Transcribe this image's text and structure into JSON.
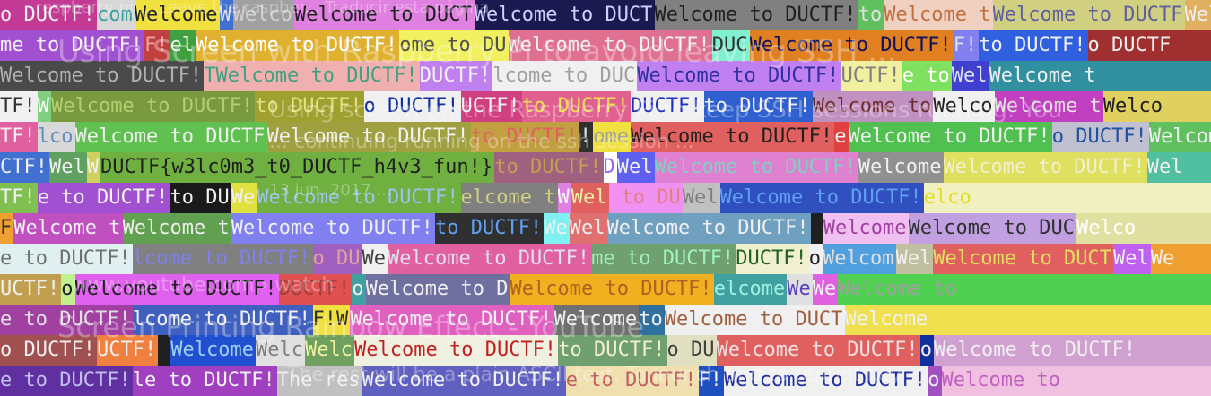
{
  "background_ghost": [
    "respberry pi ... Leave the raspber... Traducir esta página",
    "Using Screen with Raspberry Pi to avoid leaving SSH ...",
    "Using screen on the Raspberry Pi to keep SSH sessions running. You",
    "... continuing running on the ssh session ...",
    "13 jun. 2017 ...",
    "www.youtube.com › watch",
    "Screen Printing Rainbow Effect - YouTube",
    "The rest will be a plain ASCII text. To launch and to reprint key"
  ],
  "flag_text": "DUCTF{w3lc0m3_t0_DUCTF_h4v3_fun!}",
  "rows": [
    [
      [
        "o DUCTF!",
        "#c23a94",
        "#f0f0f0"
      ],
      [
        "com",
        "#d8d8d8",
        "#3aa0a0"
      ],
      [
        "Welcome",
        "#f0e040",
        "#202020"
      ],
      [
        "W",
        "#4070d0",
        "#e0e0e0"
      ],
      [
        "Welco",
        "#a0a0a0",
        "#d0d0d0"
      ],
      [
        "Welcome to DUCT",
        "#e080e0",
        "#202020"
      ],
      [
        "Welcome to DUCT",
        "#1a1a50",
        "#d0d0ff"
      ],
      [
        "Welcome to DUCTF!",
        "#808080",
        "#202020"
      ],
      [
        "to",
        "#60c060",
        "#e0e0e0"
      ],
      [
        "Welcome t",
        "#f0d0c0",
        "#c07040"
      ],
      [
        "Welcome to DUCTF",
        "#d0d080",
        "#6060a0"
      ],
      [
        "Welcome to",
        "#e0b060",
        "#f0f0f0"
      ]
    ],
    [
      [
        "me to DUCTF!",
        "#a050d0",
        "#f0f0f0"
      ],
      [
        "F!",
        "#c04040",
        "#f0a0a0"
      ],
      [
        "el",
        "#40a040",
        "#f0f0f0"
      ],
      [
        "Welcome to DUCTF!",
        "#e0b030",
        "#ffffff"
      ],
      [
        "ome to DU",
        "#f0f060",
        "#505050"
      ],
      [
        "Welcome to DUCTF!",
        "#e07090",
        "#f0f0f0"
      ],
      [
        "DUC",
        "#80f0d0",
        "#303030"
      ],
      [
        "Welcome to DUCTF!",
        "#e08020",
        "#101060"
      ],
      [
        "F!",
        "#8080f0",
        "#e0e0e0"
      ],
      [
        "to DUCTF!",
        "#3060e0",
        "#f0f0f0"
      ],
      [
        "o DUCTF",
        "#a03030",
        "#f0f0f0"
      ]
    ],
    [
      [
        "Welcome to DUCTF!",
        "#4a4a4a",
        "#b0b0b0"
      ],
      [
        "TWelcome to DUCTF!",
        "#f0b0b0",
        "#40a080"
      ],
      [
        "DUCTF!",
        "#c080f0",
        "#f0f0f0"
      ],
      [
        "lcome to DUC",
        "#f0f0f0",
        "#a0a0a0"
      ],
      [
        "Welcome to DUCTF!",
        "#c080f0",
        "#3030a0"
      ],
      [
        "UCTF!",
        "#f0f0a0",
        "#808080"
      ],
      [
        "e to",
        "#80e060",
        "#ffffff"
      ],
      [
        "Wel",
        "#4040d0",
        "#e0e0f0"
      ],
      [
        "Welcome t",
        "#3090a0",
        "#f0f0f0"
      ]
    ],
    [
      [
        "TF!",
        "#f0f0f0",
        "#303030"
      ],
      [
        "W",
        "#80d080",
        "#ffffff"
      ],
      [
        "Welcome to DUCTF!",
        "#7a9a40",
        "#b0d070"
      ],
      [
        "to DUCTF!",
        "#a0a030",
        "#e0e080"
      ],
      [
        "o DUCTF!",
        "#f0f0f0",
        "#1030a0"
      ],
      [
        "UCTF!",
        "#d04080",
        "#f0f0f0"
      ],
      [
        "to DUCTF!",
        "#e06090",
        "#f0e050"
      ],
      [
        "DUCTF!",
        "#f0f0f0",
        "#2030c0"
      ],
      [
        "to DUCTF!",
        "#3060d0",
        "#f0f0f0"
      ],
      [
        "Welcome to",
        "#c090c0",
        "#703030"
      ],
      [
        "Welco",
        "#f0f0f0",
        "#202020"
      ],
      [
        "Welcome t",
        "#c040c0",
        "#e0e0e0"
      ],
      [
        "Welco",
        "#e0d060",
        "#202020"
      ]
    ],
    [
      [
        "TF!",
        "#e060a0",
        "#f0f0f0"
      ],
      [
        "lco",
        "#d8d8d8",
        "#6090c0"
      ],
      [
        "Welcome to DUCTF",
        "#60c050",
        "#f0f0f0"
      ],
      [
        "Welcome to DUCTF!",
        "#a0a040",
        "#f0f0f0"
      ],
      [
        "to DUCTF!",
        "#c0a040",
        "#e06060"
      ],
      [
        "!",
        "#303030",
        "#e0e0e0"
      ],
      [
        "ome",
        "#f0e040",
        "#a0a0a0"
      ],
      [
        "Welcome to DUCTF!",
        "#e06060",
        "#202020"
      ],
      [
        "e",
        "#e04040",
        "#f0f0f0"
      ],
      [
        "Welcome to DUCTF!",
        "#50c050",
        "#f0f0f0"
      ],
      [
        "o DUCTF!",
        "#c0c0d0",
        "#2050a0"
      ],
      [
        "Welcome t",
        "#60c060",
        "#f0f0f0"
      ]
    ],
    [
      [
        "CTF!",
        "#4070d0",
        "#f0f0f0"
      ],
      [
        "Wel",
        "#60a060",
        "#f0f0f0"
      ],
      [
        "W",
        "#d0d060",
        "#f0f0f0"
      ],
      [
        "DUCTF{w3lc0m3_t0_DUCTF_h4v3_fun!}",
        "#70b040",
        "#202020"
      ],
      [
        "to DUCTF!",
        "#a06080",
        "#c0a050"
      ],
      [
        "D",
        "#ffffff",
        "#a060f0"
      ],
      [
        "Wel",
        "#6060f0",
        "#f0f0f0"
      ],
      [
        "Welcome to DUCTF!",
        "#e080d0",
        "#80d0c0"
      ],
      [
        "Welcome",
        "#909090",
        "#f0f0f0"
      ],
      [
        "Welcome to DUCTF!",
        "#e0e060",
        "#f0f0d0"
      ],
      [
        "Wel",
        "#50c0a0",
        "#f0f0f0"
      ]
    ],
    [
      [
        "TF!",
        "#80c050",
        "#f0f0f0"
      ],
      [
        "e to DUCTF!",
        "#a050d0",
        "#f0f0f0"
      ],
      [
        "to DU",
        "#1a1a1a",
        "#f0f0f0"
      ],
      [
        "We",
        "#e0e040",
        "#f0f0f0"
      ],
      [
        "Welcome to DUCTF!",
        "#70b040",
        "#a0c0f0"
      ],
      [
        "elcome t",
        "#808080",
        "#d0d080"
      ],
      [
        "W",
        "#e080e0",
        "#ffffff"
      ],
      [
        "Wel",
        "#e06060",
        "#f0f0a0"
      ],
      [
        "",
        "#f090f0",
        "#f0f0f0"
      ],
      [
        "to DU",
        "#f090f0",
        "#e08080"
      ],
      [
        "Wel",
        "#c0c0c0",
        "#808080"
      ],
      [
        "Welcome to DUCTF!",
        "#3050c0",
        "#60a0f0"
      ],
      [
        "elco",
        "#f0f0c0",
        "#e0e020"
      ]
    ],
    [
      [
        "F",
        "#f0a030",
        "#303030"
      ],
      [
        "Welcome t",
        "#c050c0",
        "#f0f0f0"
      ],
      [
        "Welcome t",
        "#60a050",
        "#f0f0f0"
      ],
      [
        "Welcome to DUCTF!",
        "#8080f0",
        "#f0f0f0"
      ],
      [
        "to DUCTF!",
        "#303030",
        "#60a0f0"
      ],
      [
        "We",
        "#80f0f0",
        "#f0f0f0"
      ],
      [
        "Wel",
        "#e07070",
        "#f0f0f0"
      ],
      [
        "Welcome to DUCTF!",
        "#70a0c0",
        "#f0f0f0"
      ],
      [
        "",
        "#202020",
        "#f0f0f0"
      ],
      [
        "Welcome",
        "#f0c0f0",
        "#a040a0"
      ],
      [
        "Welcome to DUC",
        "#c0a0e0",
        "#303030"
      ],
      [
        "Welco",
        "#e0e0a0",
        "#ffffff"
      ]
    ],
    [
      [
        "e to DUCTF!",
        "#e0f0f0",
        "#707070"
      ],
      [
        "lcome to DUCTF!",
        "#808080",
        "#8080f0"
      ],
      [
        "o DU",
        "#a060c0",
        "#e0a0a0"
      ],
      [
        "We",
        "#f0f0f0",
        "#404040"
      ],
      [
        "Welcome to DUCTF!",
        "#e060a0",
        "#e0e0f0"
      ],
      [
        "me to DUCTF!",
        "#70a070",
        "#a0f0c0"
      ],
      [
        "DUCTF!",
        "#f0f0d0",
        "#206020"
      ],
      [
        "o",
        "#f0f0f0",
        "#202020"
      ],
      [
        "Welcom",
        "#50a0e0",
        "#e0e0e0"
      ],
      [
        "Wel",
        "#c0c0a0",
        "#f0f0f0"
      ],
      [
        "Welcome to DUCT",
        "#e06060",
        "#e0e060"
      ],
      [
        "Wel",
        "#c060f0",
        "#f0f0f0"
      ],
      [
        "We",
        "#f0a030",
        "#f0f0f0"
      ]
    ],
    [
      [
        "UCTF!",
        "#c0a050",
        "#f0f0f0"
      ],
      [
        "o",
        "#c0f090",
        "#202020"
      ],
      [
        "Welcome to DUCTF!",
        "#e060f0",
        "#202020"
      ],
      [
        "DUCTF!",
        "#e05050",
        "#a04040"
      ],
      [
        "o",
        "#40a0a0",
        "#f0f0f0"
      ],
      [
        "Welcome to D",
        "#7070a0",
        "#f0f0f0"
      ],
      [
        "Welcome to DUCTF!",
        "#f0b020",
        "#b06020"
      ],
      [
        "elcome",
        "#40a0a0",
        "#a0f0e0"
      ],
      [
        "We",
        "#e0e0e0",
        "#6040c0"
      ],
      [
        "We",
        "#e060e0",
        "#f0f0f0"
      ],
      [
        "Welcome to",
        "#50d050",
        "#a0a0a0"
      ]
    ],
    [
      [
        "e to DUCTF!",
        "#a040a0",
        "#e0e0e0"
      ],
      [
        "lcome to DUCTF!",
        "#4060c0",
        "#f0f0f0"
      ],
      [
        "F!W",
        "#f0e040",
        "#303030"
      ],
      [
        "Welcome to DUCTF!",
        "#e060c0",
        "#f0f0f0"
      ],
      [
        "Welcome",
        "#707070",
        "#f0f0f0"
      ],
      [
        "to",
        "#3070a0",
        "#f0f0f0"
      ],
      [
        "Welcome to DUCT",
        "#f0f0f0",
        "#a06040"
      ],
      [
        "Welcome",
        "#f0e050",
        "#f0f0f0"
      ]
    ],
    [
      [
        "o DUCTF!",
        "#a05050",
        "#f0f0f0"
      ],
      [
        "UCTF!",
        "#f08040",
        "#f0f0f0"
      ],
      [
        "",
        "#202020",
        "#f0f0f0"
      ],
      [
        "Welcome",
        "#2050d0",
        "#a0d0f0"
      ],
      [
        "Welc",
        "#e0e0e0",
        "#808080"
      ],
      [
        "Welc",
        "#70a060",
        "#f0f0a0"
      ],
      [
        "Welcome to DUCTF!",
        "#f0f0e0",
        "#c02020"
      ],
      [
        "to DUCTF!",
        "#70a070",
        "#f0f0d0"
      ],
      [
        "o DU",
        "#e0e0c0",
        "#404040"
      ],
      [
        "Welcome to DUCTF!",
        "#e06060",
        "#f0e0e0"
      ],
      [
        "o",
        "#1030a0",
        "#f0f0f0"
      ],
      [
        "Welcome to DUCTF!",
        "#d0a0d0",
        "#f0f0f0"
      ]
    ],
    [
      [
        "e to DUCTF!",
        "#6030a0",
        "#c0c0f0"
      ],
      [
        "le to DUCTF!",
        "#a040c0",
        "#f0f0f0"
      ],
      [
        "The res",
        "#c0c0c0",
        "#f0f0f0"
      ],
      [
        "Welcome to DUCTF!",
        "#6060c0",
        "#f0f0f0"
      ],
      [
        "e to DUCTF!",
        "#f0e0b0",
        "#c06060"
      ],
      [
        "F!",
        "#2050c0",
        "#f0f0f0"
      ],
      [
        "Welcome to DUCTF!",
        "#f0f0f0",
        "#2030a0"
      ],
      [
        "o",
        "#a050c0",
        "#f0f0f0"
      ],
      [
        "Welcome to",
        "#f0c0e0",
        "#c060c0"
      ]
    ]
  ]
}
